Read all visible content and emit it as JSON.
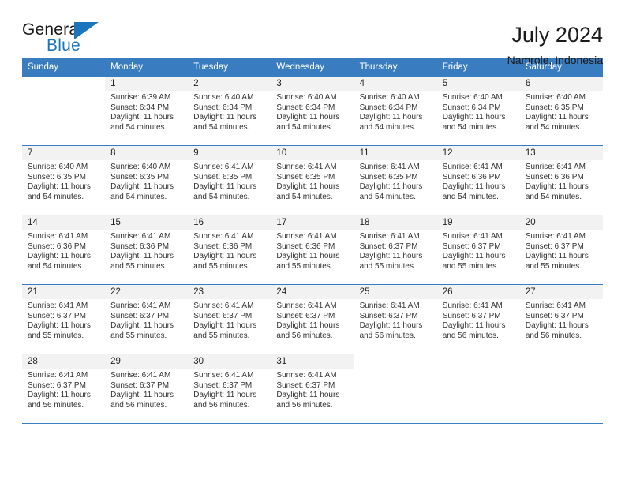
{
  "brand": {
    "name_top": "General",
    "name_bottom": "Blue",
    "accent_color": "#1b75bc",
    "triangle_icon": "brand-triangle-icon"
  },
  "header": {
    "month_title": "July 2024",
    "location": "Namrole, Indonesia"
  },
  "calendar": {
    "header_bg": "#3a7cc0",
    "daynum_bg": "#f2f2f2",
    "weekday_headers": [
      "Sunday",
      "Monday",
      "Tuesday",
      "Wednesday",
      "Thursday",
      "Friday",
      "Saturday"
    ],
    "weeks": [
      [
        {
          "day": "",
          "sunrise": "",
          "sunset": "",
          "daylight_line1": "",
          "daylight_line2": ""
        },
        {
          "day": "1",
          "sunrise": "Sunrise: 6:39 AM",
          "sunset": "Sunset: 6:34 PM",
          "daylight_line1": "Daylight: 11 hours",
          "daylight_line2": "and 54 minutes."
        },
        {
          "day": "2",
          "sunrise": "Sunrise: 6:40 AM",
          "sunset": "Sunset: 6:34 PM",
          "daylight_line1": "Daylight: 11 hours",
          "daylight_line2": "and 54 minutes."
        },
        {
          "day": "3",
          "sunrise": "Sunrise: 6:40 AM",
          "sunset": "Sunset: 6:34 PM",
          "daylight_line1": "Daylight: 11 hours",
          "daylight_line2": "and 54 minutes."
        },
        {
          "day": "4",
          "sunrise": "Sunrise: 6:40 AM",
          "sunset": "Sunset: 6:34 PM",
          "daylight_line1": "Daylight: 11 hours",
          "daylight_line2": "and 54 minutes."
        },
        {
          "day": "5",
          "sunrise": "Sunrise: 6:40 AM",
          "sunset": "Sunset: 6:34 PM",
          "daylight_line1": "Daylight: 11 hours",
          "daylight_line2": "and 54 minutes."
        },
        {
          "day": "6",
          "sunrise": "Sunrise: 6:40 AM",
          "sunset": "Sunset: 6:35 PM",
          "daylight_line1": "Daylight: 11 hours",
          "daylight_line2": "and 54 minutes."
        }
      ],
      [
        {
          "day": "7",
          "sunrise": "Sunrise: 6:40 AM",
          "sunset": "Sunset: 6:35 PM",
          "daylight_line1": "Daylight: 11 hours",
          "daylight_line2": "and 54 minutes."
        },
        {
          "day": "8",
          "sunrise": "Sunrise: 6:40 AM",
          "sunset": "Sunset: 6:35 PM",
          "daylight_line1": "Daylight: 11 hours",
          "daylight_line2": "and 54 minutes."
        },
        {
          "day": "9",
          "sunrise": "Sunrise: 6:41 AM",
          "sunset": "Sunset: 6:35 PM",
          "daylight_line1": "Daylight: 11 hours",
          "daylight_line2": "and 54 minutes."
        },
        {
          "day": "10",
          "sunrise": "Sunrise: 6:41 AM",
          "sunset": "Sunset: 6:35 PM",
          "daylight_line1": "Daylight: 11 hours",
          "daylight_line2": "and 54 minutes."
        },
        {
          "day": "11",
          "sunrise": "Sunrise: 6:41 AM",
          "sunset": "Sunset: 6:35 PM",
          "daylight_line1": "Daylight: 11 hours",
          "daylight_line2": "and 54 minutes."
        },
        {
          "day": "12",
          "sunrise": "Sunrise: 6:41 AM",
          "sunset": "Sunset: 6:36 PM",
          "daylight_line1": "Daylight: 11 hours",
          "daylight_line2": "and 54 minutes."
        },
        {
          "day": "13",
          "sunrise": "Sunrise: 6:41 AM",
          "sunset": "Sunset: 6:36 PM",
          "daylight_line1": "Daylight: 11 hours",
          "daylight_line2": "and 54 minutes."
        }
      ],
      [
        {
          "day": "14",
          "sunrise": "Sunrise: 6:41 AM",
          "sunset": "Sunset: 6:36 PM",
          "daylight_line1": "Daylight: 11 hours",
          "daylight_line2": "and 54 minutes."
        },
        {
          "day": "15",
          "sunrise": "Sunrise: 6:41 AM",
          "sunset": "Sunset: 6:36 PM",
          "daylight_line1": "Daylight: 11 hours",
          "daylight_line2": "and 55 minutes."
        },
        {
          "day": "16",
          "sunrise": "Sunrise: 6:41 AM",
          "sunset": "Sunset: 6:36 PM",
          "daylight_line1": "Daylight: 11 hours",
          "daylight_line2": "and 55 minutes."
        },
        {
          "day": "17",
          "sunrise": "Sunrise: 6:41 AM",
          "sunset": "Sunset: 6:36 PM",
          "daylight_line1": "Daylight: 11 hours",
          "daylight_line2": "and 55 minutes."
        },
        {
          "day": "18",
          "sunrise": "Sunrise: 6:41 AM",
          "sunset": "Sunset: 6:37 PM",
          "daylight_line1": "Daylight: 11 hours",
          "daylight_line2": "and 55 minutes."
        },
        {
          "day": "19",
          "sunrise": "Sunrise: 6:41 AM",
          "sunset": "Sunset: 6:37 PM",
          "daylight_line1": "Daylight: 11 hours",
          "daylight_line2": "and 55 minutes."
        },
        {
          "day": "20",
          "sunrise": "Sunrise: 6:41 AM",
          "sunset": "Sunset: 6:37 PM",
          "daylight_line1": "Daylight: 11 hours",
          "daylight_line2": "and 55 minutes."
        }
      ],
      [
        {
          "day": "21",
          "sunrise": "Sunrise: 6:41 AM",
          "sunset": "Sunset: 6:37 PM",
          "daylight_line1": "Daylight: 11 hours",
          "daylight_line2": "and 55 minutes."
        },
        {
          "day": "22",
          "sunrise": "Sunrise: 6:41 AM",
          "sunset": "Sunset: 6:37 PM",
          "daylight_line1": "Daylight: 11 hours",
          "daylight_line2": "and 55 minutes."
        },
        {
          "day": "23",
          "sunrise": "Sunrise: 6:41 AM",
          "sunset": "Sunset: 6:37 PM",
          "daylight_line1": "Daylight: 11 hours",
          "daylight_line2": "and 55 minutes."
        },
        {
          "day": "24",
          "sunrise": "Sunrise: 6:41 AM",
          "sunset": "Sunset: 6:37 PM",
          "daylight_line1": "Daylight: 11 hours",
          "daylight_line2": "and 56 minutes."
        },
        {
          "day": "25",
          "sunrise": "Sunrise: 6:41 AM",
          "sunset": "Sunset: 6:37 PM",
          "daylight_line1": "Daylight: 11 hours",
          "daylight_line2": "and 56 minutes."
        },
        {
          "day": "26",
          "sunrise": "Sunrise: 6:41 AM",
          "sunset": "Sunset: 6:37 PM",
          "daylight_line1": "Daylight: 11 hours",
          "daylight_line2": "and 56 minutes."
        },
        {
          "day": "27",
          "sunrise": "Sunrise: 6:41 AM",
          "sunset": "Sunset: 6:37 PM",
          "daylight_line1": "Daylight: 11 hours",
          "daylight_line2": "and 56 minutes."
        }
      ],
      [
        {
          "day": "28",
          "sunrise": "Sunrise: 6:41 AM",
          "sunset": "Sunset: 6:37 PM",
          "daylight_line1": "Daylight: 11 hours",
          "daylight_line2": "and 56 minutes."
        },
        {
          "day": "29",
          "sunrise": "Sunrise: 6:41 AM",
          "sunset": "Sunset: 6:37 PM",
          "daylight_line1": "Daylight: 11 hours",
          "daylight_line2": "and 56 minutes."
        },
        {
          "day": "30",
          "sunrise": "Sunrise: 6:41 AM",
          "sunset": "Sunset: 6:37 PM",
          "daylight_line1": "Daylight: 11 hours",
          "daylight_line2": "and 56 minutes."
        },
        {
          "day": "31",
          "sunrise": "Sunrise: 6:41 AM",
          "sunset": "Sunset: 6:37 PM",
          "daylight_line1": "Daylight: 11 hours",
          "daylight_line2": "and 56 minutes."
        },
        {
          "day": "",
          "sunrise": "",
          "sunset": "",
          "daylight_line1": "",
          "daylight_line2": ""
        },
        {
          "day": "",
          "sunrise": "",
          "sunset": "",
          "daylight_line1": "",
          "daylight_line2": ""
        },
        {
          "day": "",
          "sunrise": "",
          "sunset": "",
          "daylight_line1": "",
          "daylight_line2": ""
        }
      ]
    ]
  }
}
